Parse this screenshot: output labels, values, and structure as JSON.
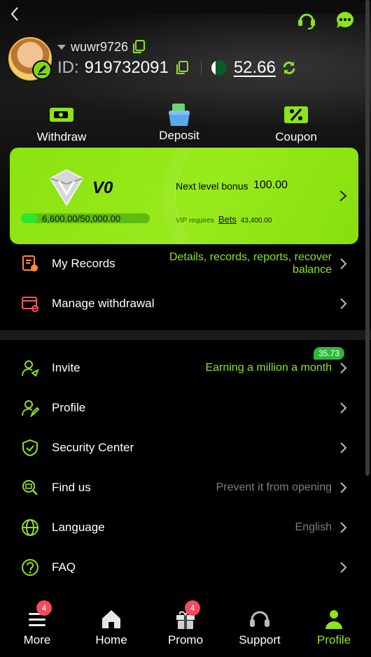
{
  "header": {
    "username": "wuwr9726",
    "id_label": "ID:",
    "id_value": "919732091",
    "balance": "52.66",
    "colors": {
      "accent": "#8ee31a",
      "badge": "#f24b5b"
    }
  },
  "quick_actions": [
    {
      "label": "Withdraw",
      "icon": "withdraw-icon"
    },
    {
      "label": "Deposit",
      "icon": "wallet-icon"
    },
    {
      "label": "Coupon",
      "icon": "coupon-icon"
    }
  ],
  "vip": {
    "level": "V0",
    "progress_text": "6,600.00/50,000.00",
    "progress_fraction": 0.132,
    "next_label": "Next level bonus",
    "next_value": "100.00",
    "req_label": "VIP requires",
    "req_link": "Bets",
    "req_value": "43,400.00"
  },
  "records": [
    {
      "label": "My Records",
      "hint": "Details, records, reports, recover balance",
      "icon": "records-icon"
    },
    {
      "label": "Manage withdrawal",
      "hint": "",
      "icon": "manage-withdrawal-icon"
    }
  ],
  "menu": [
    {
      "label": "Invite",
      "hint": "Earning a million a month",
      "icon": "invite-icon",
      "bubble": "35.73"
    },
    {
      "label": "Profile",
      "hint": "",
      "icon": "profile-icon"
    },
    {
      "label": "Security Center",
      "hint": "",
      "icon": "shield-icon"
    },
    {
      "label": "Find us",
      "hint": "Prevent it from opening",
      "icon": "find-us-icon"
    },
    {
      "label": "Language",
      "hint": "English",
      "icon": "globe-icon"
    },
    {
      "label": "FAQ",
      "hint": "",
      "icon": "help-icon"
    }
  ],
  "tabs": [
    {
      "label": "More",
      "icon": "menu-icon",
      "badge": "4"
    },
    {
      "label": "Home",
      "icon": "home-icon"
    },
    {
      "label": "Promo",
      "icon": "gift-icon",
      "badge": "4"
    },
    {
      "label": "Support",
      "icon": "headset-icon"
    },
    {
      "label": "Profile",
      "icon": "user-icon",
      "active": true
    }
  ]
}
